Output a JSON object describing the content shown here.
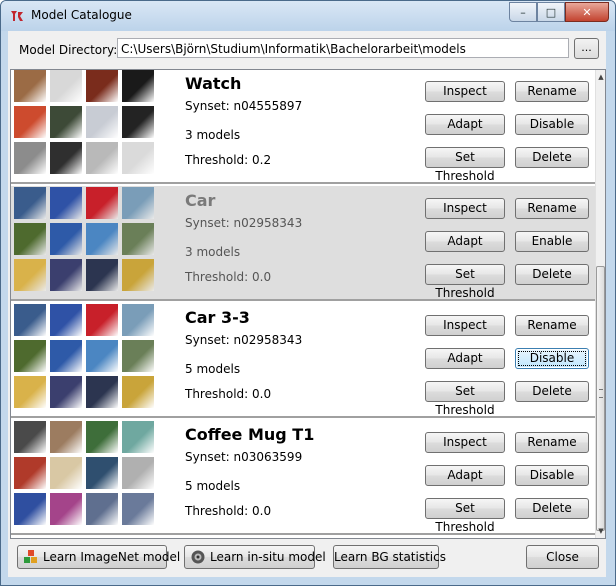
{
  "window": {
    "title": "Model Catalogue",
    "controls": {
      "minimize": "–",
      "maximize": "□",
      "close": "✕"
    }
  },
  "directory": {
    "label": "Model Directory:",
    "value": "C:\\Users\\Björn\\Studium\\Informatik\\Bachelorarbeit\\models",
    "browse_label": "..."
  },
  "models": [
    {
      "name": "Watch",
      "synset": "Synset: n04555897",
      "count": "3 models",
      "threshold": "Threshold: 0.2",
      "state": "enabled",
      "buttons": {
        "inspect": "Inspect",
        "rename": "Rename",
        "adapt": "Adapt",
        "toggle": "Disable",
        "set_threshold": "Set Threshold",
        "delete": "Delete"
      },
      "thumb_colors": [
        "#9b6b45",
        "#d8d8d8",
        "#7a2c1c",
        "#1a1a1a",
        "#cd4b2e",
        "#3d4a37",
        "#c8ccd4",
        "#232323",
        "#8c8c8c",
        "#2f2f2f",
        "#b9b9b9",
        "#dadada"
      ]
    },
    {
      "name": "Car",
      "synset": "Synset: n02958343",
      "count": "3 models",
      "threshold": "Threshold: 0.0",
      "state": "disabled",
      "buttons": {
        "inspect": "Inspect",
        "rename": "Rename",
        "adapt": "Adapt",
        "toggle": "Enable",
        "set_threshold": "Set Threshold",
        "delete": "Delete"
      },
      "thumb_colors": [
        "#3a5c8c",
        "#2f52a6",
        "#c8202a",
        "#7a9db8",
        "#4e6a2e",
        "#2e5aa8",
        "#4b86c2",
        "#6a7f58",
        "#d9b24a",
        "#3b3f6e",
        "#2c3550",
        "#c9a43a"
      ]
    },
    {
      "name": "Car 3-3",
      "synset": "Synset: n02958343",
      "count": "5 models",
      "threshold": "Threshold: 0.0",
      "state": "enabled",
      "buttons": {
        "inspect": "Inspect",
        "rename": "Rename",
        "adapt": "Adapt",
        "toggle": "Disable",
        "set_threshold": "Set Threshold",
        "delete": "Delete"
      },
      "thumb_colors": [
        "#3a5c8c",
        "#2f52a6",
        "#c8202a",
        "#7a9db8",
        "#4e6a2e",
        "#2e5aa8",
        "#4b86c2",
        "#6a7f58",
        "#d9b24a",
        "#3b3f6e",
        "#2c3550",
        "#c9a43a"
      ]
    },
    {
      "name": "Coffee Mug T1",
      "synset": "Synset: n03063599",
      "count": "5 models",
      "threshold": "Threshold: 0.0",
      "state": "enabled",
      "buttons": {
        "inspect": "Inspect",
        "rename": "Rename",
        "adapt": "Adapt",
        "toggle": "Disable",
        "set_threshold": "Set Threshold",
        "delete": "Delete"
      },
      "thumb_colors": [
        "#4a4a4a",
        "#9c7c60",
        "#3e6e3a",
        "#6fa8a0",
        "#b03a2a",
        "#d9c8a4",
        "#2f4f6f",
        "#b0b0b0",
        "#2f4fa0",
        "#a4448a",
        "#5f6f8f",
        "#6a7a9a"
      ]
    }
  ],
  "footer": {
    "learn_imagenet": "Learn ImageNet model",
    "learn_insitu": "Learn in-situ model",
    "learn_bg": "Learn BG statistics",
    "close": "Close"
  },
  "colors": {
    "disabled_row_bg": "#dedede",
    "focus_border": "#3c7fb1"
  }
}
